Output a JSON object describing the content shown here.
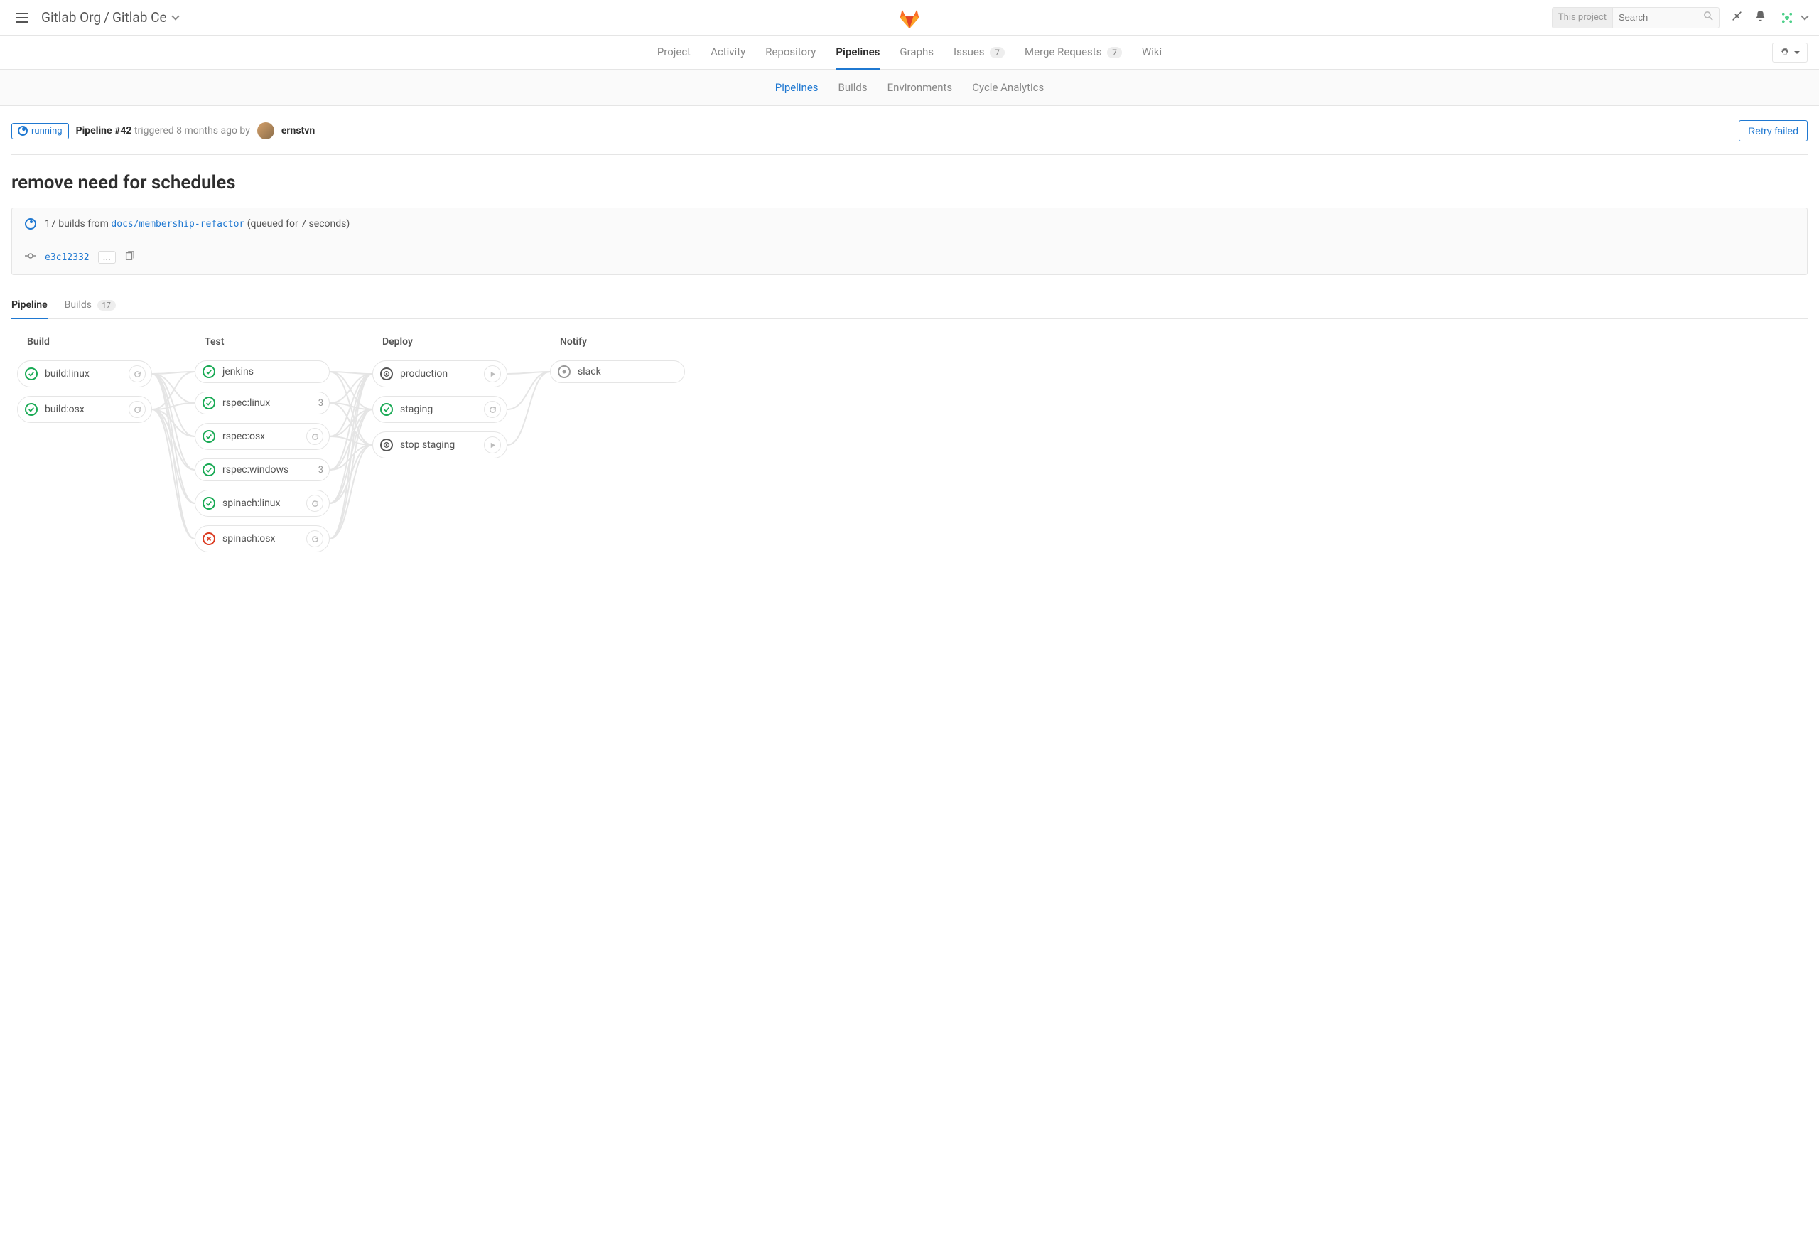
{
  "breadcrumb": {
    "org": "Gitlab Org",
    "project": "Gitlab Ce"
  },
  "search": {
    "scope": "This project",
    "placeholder": "Search"
  },
  "main_nav": {
    "project": "Project",
    "activity": "Activity",
    "repository": "Repository",
    "pipelines": "Pipelines",
    "graphs": "Graphs",
    "issues": "Issues",
    "issues_count": "7",
    "merge_requests": "Merge Requests",
    "mr_count": "7",
    "wiki": "Wiki"
  },
  "sub_nav": {
    "pipelines": "Pipelines",
    "builds": "Builds",
    "environments": "Environments",
    "cycle": "Cycle Analytics"
  },
  "status": {
    "label": "running"
  },
  "trigger": {
    "prefix": "Pipeline",
    "id": "#42",
    "mid": "triggered 8 months ago by",
    "user": "ernstvn"
  },
  "retry_label": "Retry failed",
  "title": "remove need for schedules",
  "info": {
    "builds_prefix": "17 builds from",
    "branch": "docs/membership-refactor",
    "queued": "(queued for 7 seconds)",
    "commit": "e3c12332",
    "ellipsis": "..."
  },
  "view_tabs": {
    "pipeline": "Pipeline",
    "builds": "Builds",
    "builds_count": "17"
  },
  "stages": [
    {
      "name": "Build",
      "jobs": [
        {
          "name": "build:linux",
          "status": "success",
          "action": "retry"
        },
        {
          "name": "build:osx",
          "status": "success",
          "action": "retry"
        }
      ]
    },
    {
      "name": "Test",
      "jobs": [
        {
          "name": "jenkins",
          "status": "success",
          "action": "none"
        },
        {
          "name": "rspec:linux",
          "status": "success",
          "count": "3"
        },
        {
          "name": "rspec:osx",
          "status": "success",
          "action": "retry"
        },
        {
          "name": "rspec:windows",
          "status": "success",
          "count": "3"
        },
        {
          "name": "spinach:linux",
          "status": "success",
          "action": "retry"
        },
        {
          "name": "spinach:osx",
          "status": "failed",
          "action": "retry"
        }
      ]
    },
    {
      "name": "Deploy",
      "jobs": [
        {
          "name": "production",
          "status": "manual",
          "action": "play"
        },
        {
          "name": "staging",
          "status": "success",
          "action": "retry"
        },
        {
          "name": "stop staging",
          "status": "manual",
          "action": "play"
        }
      ]
    },
    {
      "name": "Notify",
      "jobs": [
        {
          "name": "slack",
          "status": "skipped",
          "action": "none"
        }
      ]
    }
  ]
}
